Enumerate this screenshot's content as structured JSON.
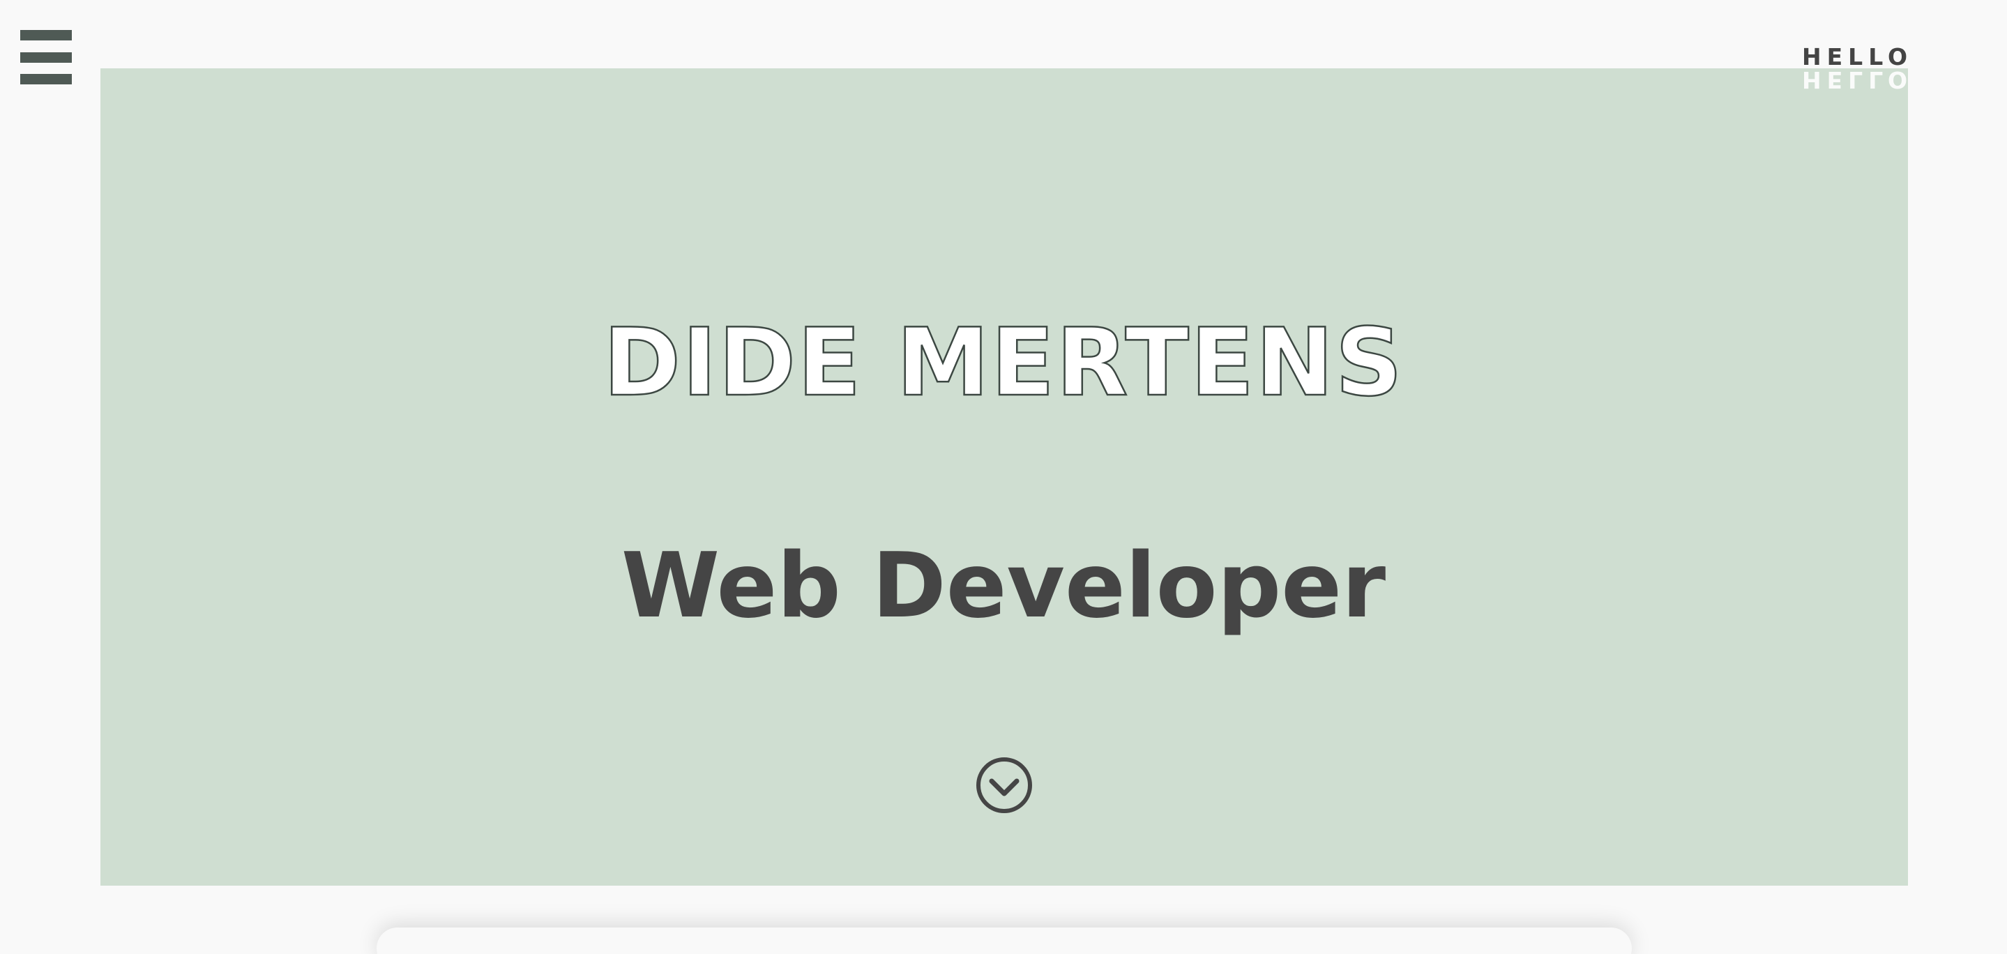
{
  "header": {
    "menu_icon": "hamburger-menu-icon",
    "logo_text": "HELLO"
  },
  "hero": {
    "name": "DIDE MERTENS",
    "role": "Web Developer",
    "scroll_icon": "chevron-down-circle-icon"
  },
  "colors": {
    "background": "#f9f9f9",
    "hero_background": "#cfded1",
    "menu_bars": "#4f5a55",
    "text_dark": "#454545",
    "name_fill": "#ffffff"
  }
}
